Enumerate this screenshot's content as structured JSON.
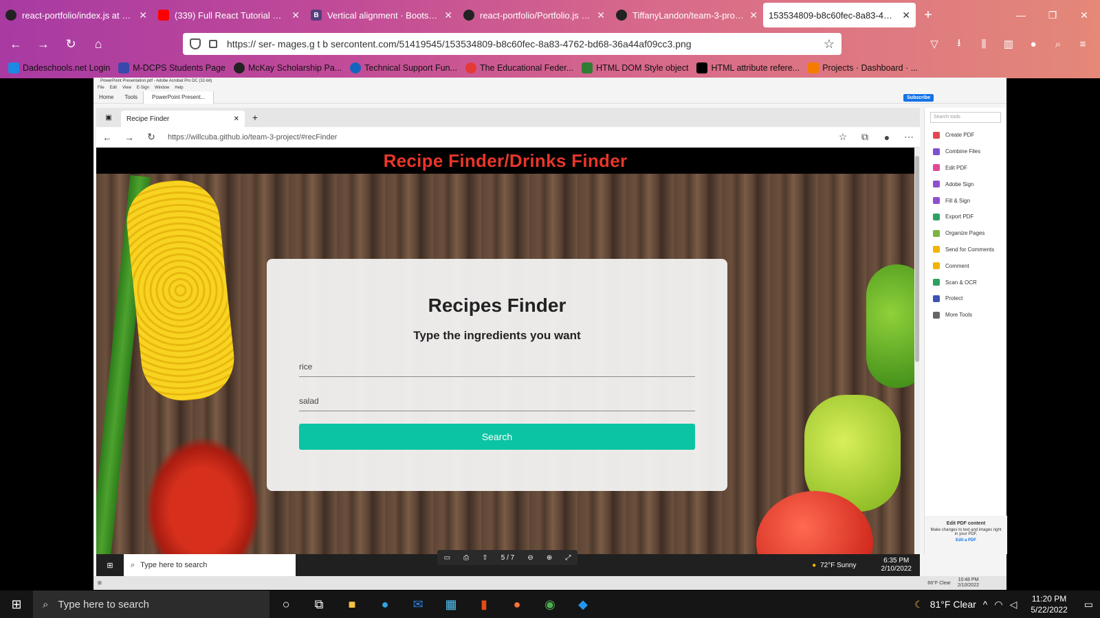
{
  "browser": {
    "tabs": [
      {
        "label": "react-portfolio/index.js at main",
        "icon": "github-icon"
      },
      {
        "label": "(339) Full React Tutorial #9 - Intr",
        "icon": "youtube-icon"
      },
      {
        "label": "Vertical alignment · Bootstrap",
        "icon": "bootstrap-icon"
      },
      {
        "label": "react-portfolio/Portfolio.js at m",
        "icon": "github-icon"
      },
      {
        "label": "TiffanyLandon/team-3-project",
        "icon": "github-icon"
      },
      {
        "label": "153534809-b8c60fec-8a83-4762-bd6",
        "icon": "image-icon"
      }
    ],
    "url": "https://  ser- mages.g t    b  sercontent.com/51419545/153534809-b8c60fec-8a83-4762-bd68-36a44af09cc3.png",
    "bookmarks": [
      "Dadeschools.net Login",
      "M-DCPS Students Page",
      "McKay Scholarship Pa...",
      "Technical Support Fun...",
      "The Educational Feder...",
      "HTML DOM Style object",
      "HTML attribute refere...",
      "Projects · Dashboard · ..."
    ]
  },
  "acrobat": {
    "title": "PowerPoint Presentation.pdf - Adobe Acrobat Pro DC (32-bit)",
    "menu": [
      "File",
      "Edit",
      "View",
      "E-Sign",
      "Window",
      "Help"
    ],
    "tabs": [
      "Home",
      "Tools",
      "PowerPoint Present..."
    ],
    "subscribe": "Subscribe",
    "search_tools": "Search tools",
    "tools": [
      "Create PDF",
      "Combine Files",
      "Edit PDF",
      "Adobe Sign",
      "Fill & Sign",
      "Export PDF",
      "Organize Pages",
      "Send for Comments",
      "Comment",
      "Scan & OCR",
      "Protect",
      "More Tools"
    ],
    "footer_title": "Edit PDF content",
    "footer_text": "Make changes to text and images right in your PDF.",
    "footer_link": "Edit a PDF",
    "page_indicator": "5 / 7",
    "taskbar_weather": "66°F  Clear",
    "taskbar_time": "10:48 PM",
    "taskbar_date": "2/10/2022"
  },
  "edge": {
    "tab_title": "Recipe Finder",
    "url": "https://willcuba.github.io/team-3-project/#recFinder"
  },
  "site": {
    "header": "Recipe Finder/Drinks Finder",
    "card_title": "Recipes Finder",
    "card_subtitle": "Type the ingredients you want",
    "input1": "rice",
    "input2": "salad",
    "button": "Search"
  },
  "inner_taskbar": {
    "search": "Type here to search",
    "weather": "72°F  Sunny",
    "time": "6:35 PM",
    "date": "2/10/2022"
  },
  "taskbar": {
    "search": "Type here to search",
    "weather": "81°F  Clear",
    "time": "11:20 PM",
    "date": "5/22/2022"
  }
}
